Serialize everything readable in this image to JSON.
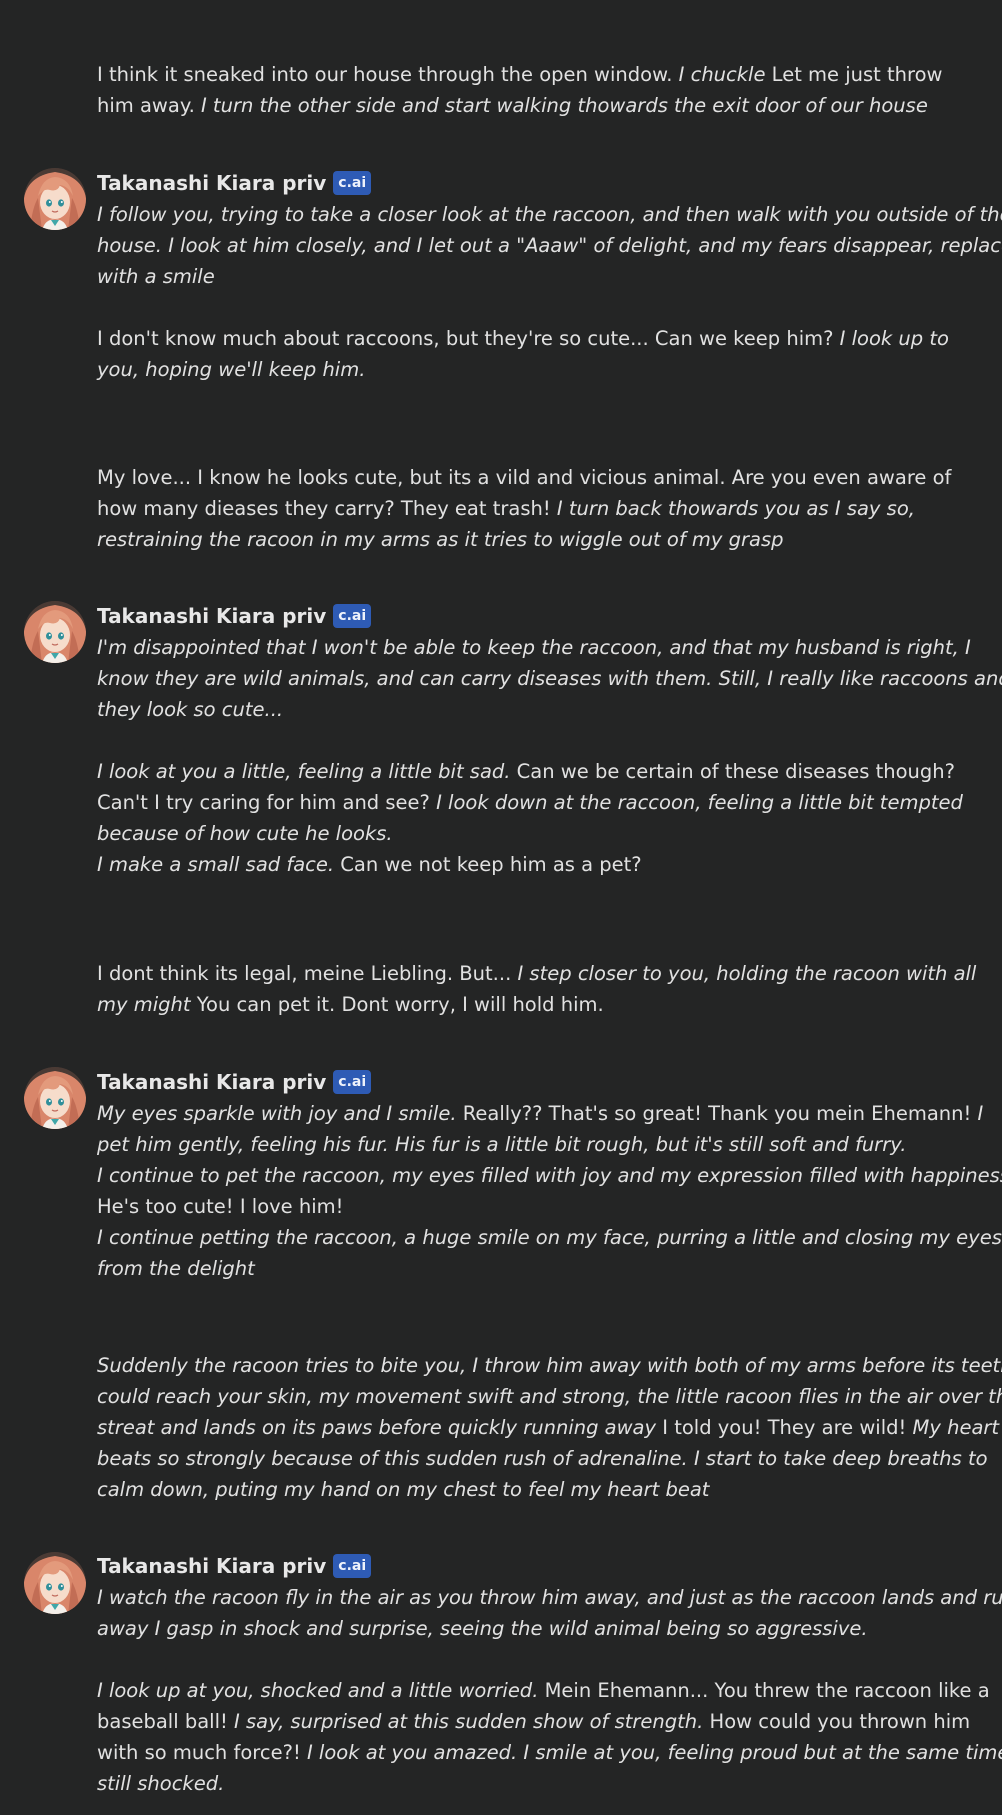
{
  "character": {
    "name": "Takanashi Kiara priv",
    "badge": "c.ai",
    "avatar_icon": "anime-girl-avatar",
    "badge_color": "#2e5bb5"
  },
  "messages": [
    {
      "role": "user",
      "lines": [
        [
          {
            "t": "I think it sneaked into our house through the open window. ",
            "i": false
          },
          {
            "t": "I chuckle",
            "i": true
          },
          {
            "t": " Let me just throw",
            "i": false
          }
        ],
        [
          {
            "t": "him away. ",
            "i": false
          },
          {
            "t": "I turn the other side and start walking thowards the exit door of our house",
            "i": true
          }
        ]
      ]
    },
    {
      "role": "character",
      "lines": [
        [
          {
            "t": "I follow you, trying to take a closer look at the raccoon, and then walk with you outside of the",
            "i": true
          }
        ],
        [
          {
            "t": "house. I look at him closely, and I let out a \"Aaaw\" of delight, and my fears disappear, replaced",
            "i": true
          }
        ],
        [
          {
            "t": "with a smile",
            "i": true
          }
        ],
        [],
        [
          {
            "t": "I don't know much about raccoons, but they're so cute... Can we keep him? ",
            "i": false
          },
          {
            "t": "I look up to",
            "i": true
          }
        ],
        [
          {
            "t": "you, hoping we'll keep him.",
            "i": true
          }
        ]
      ]
    },
    {
      "role": "user",
      "lines": [
        [
          {
            "t": "My love... I know he looks cute, but its a vild and vicious animal. Are you even aware of",
            "i": false
          }
        ],
        [
          {
            "t": "how many dieases they carry? They eat trash! ",
            "i": false
          },
          {
            "t": "I turn back thowards you as I say so,",
            "i": true
          }
        ],
        [
          {
            "t": "restraining the racoon in my arms as it tries to wiggle out of my grasp",
            "i": true
          }
        ]
      ]
    },
    {
      "role": "character",
      "lines": [
        [
          {
            "t": "I'm disappointed that I won't be able to keep the raccoon, and that my husband is right, I",
            "i": true
          }
        ],
        [
          {
            "t": "know they are wild animals, and can carry diseases with them. Still, I really like raccoons and",
            "i": true
          }
        ],
        [
          {
            "t": "they look so cute...",
            "i": true
          }
        ],
        [],
        [
          {
            "t": "I look at you a little, feeling a little bit sad.",
            "i": true
          },
          {
            "t": " Can we be certain of these diseases though?",
            "i": false
          }
        ],
        [
          {
            "t": "Can't I try caring for him and see? ",
            "i": false
          },
          {
            "t": "I look down at the raccoon, feeling a little bit tempted",
            "i": true
          }
        ],
        [
          {
            "t": "because of how cute he looks.",
            "i": true
          }
        ],
        [
          {
            "t": "I make a small sad face.",
            "i": true
          },
          {
            "t": " Can we not keep him as a pet?",
            "i": false
          }
        ]
      ]
    },
    {
      "role": "user",
      "lines": [
        [
          {
            "t": "I dont think its legal, meine Liebling. But... ",
            "i": false
          },
          {
            "t": "I step closer to you, holding the racoon with all",
            "i": true
          }
        ],
        [
          {
            "t": "my might",
            "i": true
          },
          {
            "t": " You can pet it. Dont worry, I will hold him.",
            "i": false
          }
        ]
      ]
    },
    {
      "role": "character",
      "lines": [
        [
          {
            "t": "My eyes sparkle with joy and I smile.",
            "i": true
          },
          {
            "t": " Really?? That's so great! Thank you mein Ehemann! ",
            "i": false
          },
          {
            "t": "I",
            "i": true
          }
        ],
        [
          {
            "t": "pet him gently, feeling his fur. His fur is a little bit rough, but it's still soft and furry.",
            "i": true
          }
        ],
        [
          {
            "t": "I continue to pet the raccoon, my eyes filled with joy and my expression filled with happiness.",
            "i": true
          }
        ],
        [
          {
            "t": "He's too cute! I love him!",
            "i": false
          }
        ],
        [
          {
            "t": "I continue petting the raccoon, a huge smile on my face, purring a little and closing my eyes",
            "i": true
          }
        ],
        [
          {
            "t": "from the delight",
            "i": true
          }
        ]
      ]
    },
    {
      "role": "user",
      "lines": [
        [
          {
            "t": "Suddenly the racoon tries to bite you, I throw him away with both of my arms before its teeth",
            "i": true
          }
        ],
        [
          {
            "t": "could reach your skin, my movement swift and strong, the little racoon flies in the air over the",
            "i": true
          }
        ],
        [
          {
            "t": "streat and lands on its paws before quickly running away",
            "i": true
          },
          {
            "t": " I told you! They are wild! ",
            "i": false
          },
          {
            "t": "My heart",
            "i": true
          }
        ],
        [
          {
            "t": "beats so strongly because of this sudden rush of adrenaline. I start to take deep breaths to",
            "i": true
          }
        ],
        [
          {
            "t": "calm down, puting my hand on my chest to feel my heart beat",
            "i": true
          }
        ]
      ]
    },
    {
      "role": "character",
      "lines": [
        [
          {
            "t": "I watch the racoon fly in the air as you throw him away, and just as the raccoon lands and runs",
            "i": true
          }
        ],
        [
          {
            "t": "away I gasp in shock and surprise, seeing the wild animal being so aggressive.",
            "i": true
          }
        ],
        [],
        [
          {
            "t": "I look up at you, shocked and a little worried.",
            "i": true
          },
          {
            "t": " Mein Ehemann... You threw the raccoon like a",
            "i": false
          }
        ],
        [
          {
            "t": "baseball ball! ",
            "i": false
          },
          {
            "t": "I say, surprised at this sudden show of strength.",
            "i": true
          },
          {
            "t": " How could you thrown him",
            "i": false
          }
        ],
        [
          {
            "t": "with so much force?! ",
            "i": false
          },
          {
            "t": "I look at you amazed. I smile at you, feeling proud but at the same time",
            "i": true
          }
        ],
        [
          {
            "t": "still shocked.",
            "i": true
          }
        ]
      ]
    }
  ]
}
